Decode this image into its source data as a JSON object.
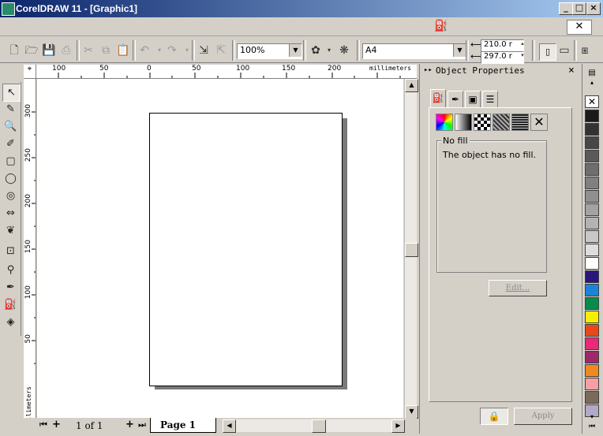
{
  "window": {
    "title": "CorelDRAW 11 - [Graphic1]"
  },
  "toolbar": {
    "zoom": "100%",
    "paper": "A4",
    "width": "210.0 r",
    "height": "297.0 r"
  },
  "ruler_h": {
    "labels": [
      "100",
      "50",
      "0",
      "50",
      "100",
      "150",
      "200"
    ],
    "units": "millimeters"
  },
  "ruler_v": {
    "labels": [
      "300",
      "250",
      "200",
      "150",
      "100",
      "50"
    ],
    "units": "millimeters"
  },
  "page_nav": {
    "count": "1 of 1",
    "tab": "Page 1"
  },
  "docker": {
    "title": "Object Properties",
    "fill_group_label": "No fill",
    "fill_message": "The object has no fill.",
    "edit_button": "Edit...",
    "apply_button": "Apply"
  },
  "palette": {
    "colors": [
      "#1a1a1a",
      "#333333",
      "#474747",
      "#5a5a5a",
      "#6e6e6e",
      "#808080",
      "#8f8f8f",
      "#a3a3a3",
      "#b3b3b3",
      "#c8c8c8",
      "#dedede",
      "#ffffff",
      "#2a167a",
      "#1a84d8",
      "#0a8a4a",
      "#f5f000",
      "#e8481a",
      "#e82a78",
      "#9a2a6a",
      "#f08a1a",
      "#f4a0a0",
      "#7a6a5a",
      "#b4a8c8"
    ]
  }
}
